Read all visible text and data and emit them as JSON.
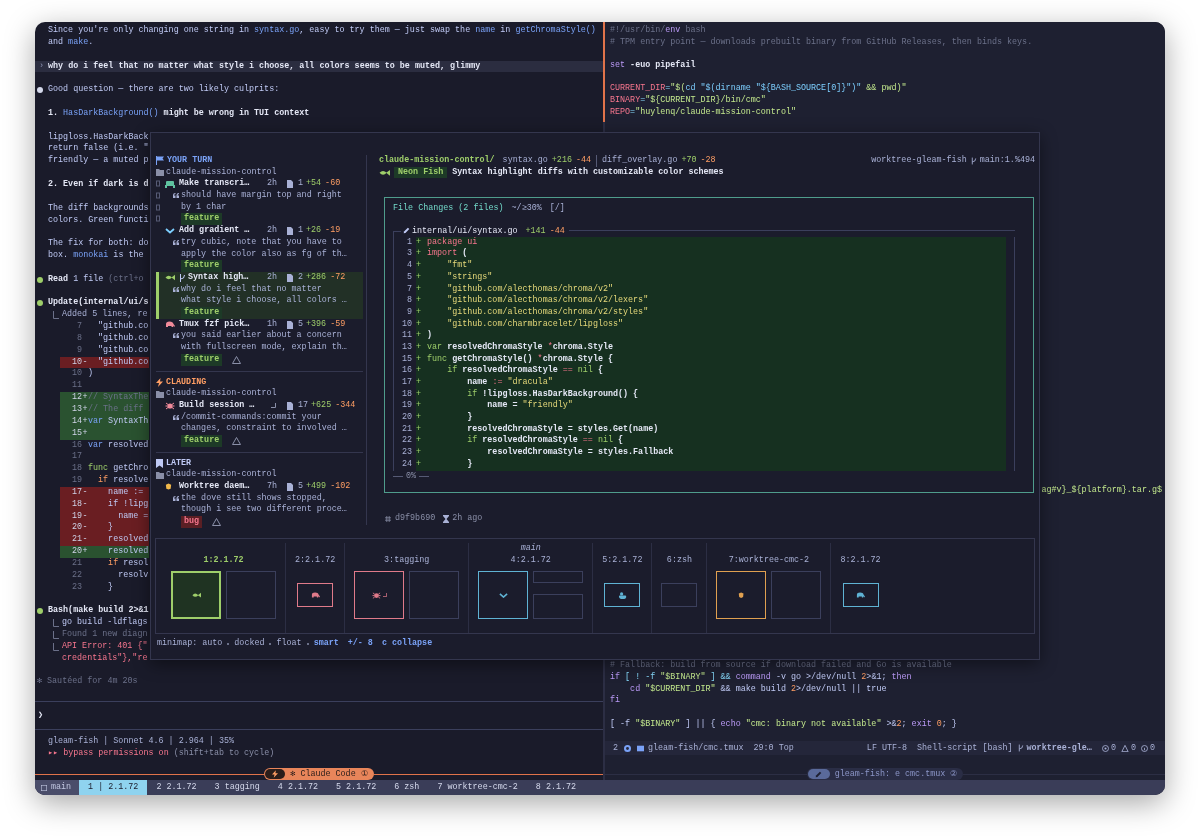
{
  "claude_pane": {
    "lines": [
      {
        "kind": "text",
        "parts": [
          {
            "t": "Since you're only changing one string in ",
            "kind": "plain"
          },
          {
            "t": "syntax.go",
            "kind": "code"
          },
          {
            "t": ", easy to try them — just swap the ",
            "kind": "plain"
          },
          {
            "t": "name",
            "kind": "code"
          },
          {
            "t": " in ",
            "kind": "plain"
          },
          {
            "t": "getChromaStyle()",
            "kind": "code"
          }
        ]
      },
      {
        "kind": "text",
        "parts": [
          {
            "t": "and ",
            "kind": "plain"
          },
          {
            "t": "make",
            "kind": "code"
          },
          {
            "t": ".",
            "kind": "plain"
          }
        ]
      },
      {
        "kind": "blank"
      },
      {
        "kind": "user",
        "marker": "›",
        "parts": [
          {
            "t": "why do i feel that no matter what style i choose, all colors seems to be muted, glimmy",
            "kind": "bold"
          }
        ]
      },
      {
        "kind": "blank"
      },
      {
        "kind": "bullet",
        "color": "#d5d9ec",
        "parts": [
          {
            "t": "Good question — there are two likely culprits:",
            "kind": "plain"
          }
        ]
      },
      {
        "kind": "blank"
      },
      {
        "kind": "text",
        "parts": [
          {
            "t": "1. ",
            "kind": "bold"
          },
          {
            "t": "HasDarkBackground()",
            "kind": "code"
          },
          {
            "t": " might be wrong in TUI context",
            "kind": "bold"
          }
        ]
      },
      {
        "kind": "blank"
      },
      {
        "kind": "text",
        "parts": [
          {
            "t": "lipgloss.HasDarkBack",
            "kind": "plain"
          }
        ]
      },
      {
        "kind": "text",
        "parts": [
          {
            "t": "return false (i.e. \"",
            "kind": "plain"
          }
        ]
      },
      {
        "kind": "text",
        "parts": [
          {
            "t": "friendly — a muted p",
            "kind": "plain"
          }
        ]
      },
      {
        "kind": "blank"
      },
      {
        "kind": "text",
        "parts": [
          {
            "t": "2. Even if dark is d",
            "kind": "bold"
          }
        ]
      },
      {
        "kind": "blank"
      },
      {
        "kind": "text",
        "parts": [
          {
            "t": "The diff backgrounds",
            "kind": "plain"
          }
        ]
      },
      {
        "kind": "text",
        "parts": [
          {
            "t": "colors. Green functi",
            "kind": "plain"
          }
        ]
      },
      {
        "kind": "blank"
      },
      {
        "kind": "text",
        "parts": [
          {
            "t": "The fix for both: do",
            "kind": "plain"
          }
        ]
      },
      {
        "kind": "text",
        "parts": [
          {
            "t": "box. ",
            "kind": "plain"
          },
          {
            "t": "monokai",
            "kind": "code"
          },
          {
            "t": " is the",
            "kind": "plain"
          }
        ]
      },
      {
        "kind": "blank"
      },
      {
        "kind": "bullet",
        "color": "#9ece6a",
        "parts": [
          {
            "t": "Read",
            "kind": "bold"
          },
          {
            "t": " 1 file ",
            "kind": "plain"
          },
          {
            "t": "(ctrl+o",
            "kind": "dim"
          }
        ]
      },
      {
        "kind": "blank"
      },
      {
        "kind": "bullet",
        "color": "#9ece6a",
        "parts": [
          {
            "t": "Update(internal/ui/s",
            "kind": "bold"
          }
        ]
      },
      {
        "kind": "output",
        "parts": [
          {
            "t": "Added 5 lines, re",
            "kind": "muted"
          }
        ]
      },
      {
        "kind": "diff_ctx",
        "num": "7",
        "parts": [
          {
            "t": "  \"github.co",
            "kind": "plain"
          }
        ]
      },
      {
        "kind": "diff_ctx",
        "num": "8",
        "parts": [
          {
            "t": "  \"github.co",
            "kind": "plain"
          }
        ]
      },
      {
        "kind": "diff_ctx",
        "num": "9",
        "parts": [
          {
            "t": "  \"github.co",
            "kind": "plain"
          }
        ]
      },
      {
        "kind": "diff_del",
        "num": "10",
        "sign": "-",
        "parts": [
          {
            "t": "  \"github.co",
            "kind": "plain"
          }
        ]
      },
      {
        "kind": "diff_ctx",
        "num": "10",
        "parts": [
          {
            "t": ")",
            "kind": "plain"
          }
        ]
      },
      {
        "kind": "diff_ctx",
        "num": "11"
      },
      {
        "kind": "diff_add",
        "num": "12",
        "sign": "+",
        "parts": [
          {
            "t": "// SyntaxThe",
            "kind": "dim"
          }
        ]
      },
      {
        "kind": "diff_add",
        "num": "13",
        "sign": "+",
        "parts": [
          {
            "t": "// The diff",
            "kind": "dim"
          }
        ]
      },
      {
        "kind": "diff_add",
        "num": "14",
        "sign": "+",
        "parts": [
          {
            "t": "var",
            "kind": "code"
          },
          {
            "t": " SyntaxTh",
            "kind": "plain"
          }
        ]
      },
      {
        "kind": "diff_add",
        "num": "15",
        "sign": "+"
      },
      {
        "kind": "diff_ctx",
        "num": "16",
        "parts": [
          {
            "t": "var",
            "kind": "code"
          },
          {
            "t": " resolved",
            "kind": "plain"
          }
        ]
      },
      {
        "kind": "diff_ctx",
        "num": "17"
      },
      {
        "kind": "diff_ctx",
        "num": "18",
        "parts": [
          {
            "t": "func",
            "kind": "gokw"
          },
          {
            "t": " getChro",
            "kind": "plain"
          }
        ]
      },
      {
        "kind": "diff_ctx",
        "num": "19",
        "parts": [
          {
            "t": "  if",
            "kind": "num"
          },
          {
            "t": " resolve",
            "kind": "plain"
          }
        ]
      },
      {
        "kind": "diff_del",
        "num": "17",
        "sign": "-",
        "parts": [
          {
            "t": "    name :=",
            "kind": "plain"
          }
        ]
      },
      {
        "kind": "diff_del",
        "num": "18",
        "sign": "-",
        "parts": [
          {
            "t": "    if !lipg",
            "kind": "plain"
          }
        ]
      },
      {
        "kind": "diff_del",
        "num": "19",
        "sign": "-",
        "parts": [
          {
            "t": "      name =",
            "kind": "plain"
          }
        ]
      },
      {
        "kind": "diff_del",
        "num": "20",
        "sign": "-",
        "parts": [
          {
            "t": "    }",
            "kind": "plain"
          }
        ]
      },
      {
        "kind": "diff_del",
        "num": "21",
        "sign": "-",
        "parts": [
          {
            "t": "    resolved",
            "kind": "plain"
          }
        ]
      },
      {
        "kind": "diff_add",
        "num": "20",
        "sign": "+",
        "parts": [
          {
            "t": "    resolved",
            "kind": "plain"
          }
        ]
      },
      {
        "kind": "diff_ctx",
        "num": "21",
        "parts": [
          {
            "t": "    if",
            "kind": "num"
          },
          {
            "t": " resol",
            "kind": "plain"
          }
        ]
      },
      {
        "kind": "diff_ctx",
        "num": "22",
        "parts": [
          {
            "t": "      resolv",
            "kind": "plain"
          }
        ]
      },
      {
        "kind": "diff_ctx",
        "num": "23",
        "parts": [
          {
            "t": "    }",
            "kind": "plain"
          }
        ]
      },
      {
        "kind": "blank"
      },
      {
        "kind": "bullet",
        "color": "#9ece6a",
        "parts": [
          {
            "t": "Bash(make build 2>&1",
            "kind": "bold"
          }
        ]
      },
      {
        "kind": "output",
        "parts": [
          {
            "t": "go build -ldflags",
            "kind": "plain"
          }
        ]
      },
      {
        "kind": "output",
        "parts": [
          {
            "t": "Found 1 new diagn",
            "kind": "dim"
          }
        ]
      },
      {
        "kind": "output",
        "parts": [
          {
            "t": "API Error: 401 {\"",
            "kind": "error"
          }
        ]
      },
      {
        "kind": "output_cont",
        "parts": [
          {
            "t": "credentials\"},\"re",
            "kind": "error"
          }
        ]
      },
      {
        "kind": "blank"
      },
      {
        "kind": "note",
        "parts": [
          {
            "t": "✻ Sautéed for 4m 20s",
            "kind": "dim"
          }
        ]
      }
    ],
    "prompt": "❯",
    "status": "gleam-fish | Sonnet 4.6 | 2.964 | 35%",
    "mode": {
      "marker": "▸▸",
      "label": "bypass permissions on",
      "hint": "(shift+tab to cycle)"
    },
    "border_title": "✻ Claude Code ①"
  },
  "editor_pane": {
    "top_lines": [
      {
        "kind": "code",
        "parts": [
          {
            "t": "#!/usr/bin/",
            "kind": "dim"
          },
          {
            "t": "env",
            "kind": "kw"
          },
          {
            "t": " bash",
            "kind": "dim"
          }
        ]
      },
      {
        "kind": "code",
        "parts": [
          {
            "t": "# TPM entry point — downloads prebuilt binary from GitHub Releases, then binds keys.",
            "kind": "dim"
          }
        ]
      },
      {
        "kind": "blank"
      },
      {
        "kind": "code",
        "parts": [
          {
            "t": "set",
            "kind": "kw"
          },
          {
            "t": " -euo pipefail",
            "kind": "bold"
          }
        ]
      },
      {
        "kind": "blank"
      },
      {
        "kind": "code",
        "parts": [
          {
            "t": "CURRENT_DIR",
            "kind": "var"
          },
          {
            "t": "=",
            "kind": "op"
          },
          {
            "t": "\"$(",
            "kind": "str"
          },
          {
            "t": "cd \"$(dirname \"${BASH_SOURCE[0]}\")\"",
            "kind": "interp"
          },
          {
            "t": " && pwd)\"",
            "kind": "str"
          }
        ]
      },
      {
        "kind": "code",
        "parts": [
          {
            "t": "BINARY",
            "kind": "var"
          },
          {
            "t": "=",
            "kind": "op"
          },
          {
            "t": "\"${CURRENT_DIR}/bin/cmc\"",
            "kind": "str"
          }
        ]
      },
      {
        "kind": "code",
        "parts": [
          {
            "t": "REPO",
            "kind": "var"
          },
          {
            "t": "=",
            "kind": "op"
          },
          {
            "t": "\"huylenq/claude-mission-control\"",
            "kind": "str"
          }
        ]
      }
    ],
    "side_line": {
      "kind": "code",
      "parts": [
        {
          "t": "ag#v}_${platform}.tar.g$",
          "kind": "str"
        }
      ]
    },
    "bottom_lines": [
      {
        "kind": "code",
        "parts": [
          {
            "t": "# Fallback: build from source if download failed and Go is available",
            "kind": "dim"
          }
        ]
      },
      {
        "kind": "code",
        "parts": [
          {
            "t": "if",
            "kind": "kw"
          },
          {
            "t": " [ ! -f ",
            "kind": "op"
          },
          {
            "t": "\"$BINARY\"",
            "kind": "str"
          },
          {
            "t": " ] && ",
            "kind": "op"
          },
          {
            "t": "command",
            "kind": "kw"
          },
          {
            "t": " -v go >/dev/null ",
            "kind": "plain"
          },
          {
            "t": "2",
            "kind": "num"
          },
          {
            "t": ">&1; ",
            "kind": "plain"
          },
          {
            "t": "then",
            "kind": "kw"
          }
        ]
      },
      {
        "kind": "code",
        "parts": [
          {
            "t": "    cd ",
            "kind": "kw"
          },
          {
            "t": "\"$CURRENT_DIR\"",
            "kind": "str"
          },
          {
            "t": " && make build ",
            "kind": "plain"
          },
          {
            "t": "2",
            "kind": "num"
          },
          {
            "t": ">/dev/null || true",
            "kind": "plain"
          }
        ]
      },
      {
        "kind": "code",
        "parts": [
          {
            "t": "fi",
            "kind": "kw"
          }
        ]
      },
      {
        "kind": "blank"
      },
      {
        "kind": "code",
        "parts": [
          {
            "t": "[ -f ",
            "kind": "plain"
          },
          {
            "t": "\"$BINARY\"",
            "kind": "str"
          },
          {
            "t": " ] || { ",
            "kind": "plain"
          },
          {
            "t": "echo",
            "kind": "kw"
          },
          {
            "t": " \"cmc: binary not available\"",
            "kind": "str"
          },
          {
            "t": " >&",
            "kind": "plain"
          },
          {
            "t": "2",
            "kind": "num"
          },
          {
            "t": "; ",
            "kind": "plain"
          },
          {
            "t": "exit ",
            "kind": "kw"
          },
          {
            "t": "0",
            "kind": "num"
          },
          {
            "t": "; }",
            "kind": "plain"
          }
        ]
      }
    ],
    "status_line": {
      "pane": "2",
      "file": "gleam-fish/cmc.tmux",
      "position": "29:0",
      "scroll": "Top",
      "eol": "LF",
      "encoding": "UTF-8",
      "filetype": "Shell-script [bash]",
      "branch": "worktree-gle…",
      "errors": "0",
      "warnings": "0",
      "infos": "0"
    },
    "border_title": "gleam-fish: e cmc.tmux ②"
  },
  "overlay": {
    "groups": [
      {
        "kind": "turn",
        "label": "YOUR TURN",
        "folder": "claude-mission-control",
        "sessions": [
          {
            "kind": "creature",
            "color": "#5fc2a0",
            "title": "Make transcri…",
            "branch": false,
            "busy": false,
            "age": "2h",
            "files": "1",
            "added": "+54",
            "removed": "-60",
            "quote_lines": [
              "should have margin top and right",
              "by 1 char"
            ],
            "tag": {
              "label": "feature",
              "kind": "feature"
            },
            "warning": false,
            "marked": true,
            "selected": false
          },
          {
            "kind": "chevron",
            "color": "#7dcfff",
            "title": "Add gradient …",
            "branch": false,
            "busy": false,
            "age": "2h",
            "files": "1",
            "added": "+26",
            "removed": "-19",
            "quote_lines": [
              "try cubic, note that you have to",
              "apply the color also as fg of th…"
            ],
            "tag": {
              "label": "feature",
              "kind": "feature"
            },
            "warning": false,
            "marked": false,
            "selected": false
          },
          {
            "kind": "fish",
            "color": "#9ece6a",
            "title": "Syntax high…",
            "branch": true,
            "busy": false,
            "age": "2h",
            "files": "2",
            "added": "+286",
            "removed": "-72",
            "quote_lines": [
              "why do i feel that no matter",
              "what style i choose, all colors …"
            ],
            "tag": {
              "label": "feature",
              "kind": "feature"
            },
            "warning": false,
            "marked": false,
            "selected": true
          },
          {
            "kind": "elephant",
            "color": "#f08a9a",
            "title": "Tmux fzf pick…",
            "branch": false,
            "busy": false,
            "age": "1h",
            "files": "5",
            "added": "+396",
            "removed": "-59",
            "quote_lines": [
              "you said earlier about a concern",
              "with fullscreen mode, explain th…"
            ],
            "tag": {
              "label": "feature",
              "kind": "feature"
            },
            "warning": true,
            "marked": false,
            "selected": false
          }
        ]
      },
      {
        "kind": "busy",
        "label": "CLAUDING",
        "folder": "claude-mission-control",
        "sessions": [
          {
            "kind": "bug",
            "color": "#f08a9a",
            "title": "Build session …",
            "branch": false,
            "busy": true,
            "files": "17",
            "added": "+625",
            "removed": "-344",
            "quote_lines": [
              "/commit-commands:commit your",
              "changes, constraint to involved …"
            ],
            "tag": {
              "label": "feature",
              "kind": "feature"
            },
            "warning": true,
            "marked": false,
            "selected": false
          }
        ]
      },
      {
        "kind": "later",
        "label": "LATER",
        "folder": "claude-mission-control",
        "sessions": [
          {
            "kind": "blob",
            "color": "#f2b84b",
            "title": "Worktree daem…",
            "branch": false,
            "busy": false,
            "age": "7h",
            "files": "5",
            "added": "+499",
            "removed": "-102",
            "quote_lines": [
              "the dove still shows stopped,",
              "though i see two different proce…"
            ],
            "tag": {
              "label": "bug",
              "kind": "bug"
            },
            "warning": true,
            "marked": false,
            "selected": false
          }
        ]
      }
    ],
    "detail": {
      "repo": "claude-mission-control/",
      "files": [
        {
          "name": "syntax.go",
          "added": "+216",
          "removed": "-44"
        },
        {
          "name": "diff_overlay.go",
          "added": "+70",
          "removed": "-28"
        }
      ],
      "worktree": "worktree-gleam-fish",
      "branch": "main:1.%494",
      "agent": "Neon Fish",
      "title": "Syntax highlight diffs with customizable color schemes",
      "changes": {
        "title": "File Changes (2 files)",
        "scope": "~/≥30%",
        "filter": "[/]",
        "file": {
          "path": "internal/ui/syntax.go",
          "added": "+141",
          "removed": "-44",
          "progress": "0%",
          "lines": [
            {
              "num": "1",
              "sign": "+",
              "parts": [
                {
                  "t": "package ui",
                  "kind": "gopunct"
                }
              ]
            },
            {
              "num": "3",
              "sign": "+",
              "parts": [
                {
                  "t": "import",
                  "kind": "gopunct"
                },
                {
                  "t": " (",
                  "kind": "bold"
                }
              ]
            },
            {
              "num": "4",
              "sign": "+",
              "parts": [
                {
                  "t": "    \"fmt\"",
                  "kind": "gostr"
                }
              ]
            },
            {
              "num": "5",
              "sign": "+",
              "parts": [
                {
                  "t": "    \"strings\"",
                  "kind": "gostr"
                }
              ]
            },
            {
              "num": "7",
              "sign": "+",
              "parts": [
                {
                  "t": "    \"github.com/alecthomas/chroma/v2\"",
                  "kind": "gostr"
                }
              ]
            },
            {
              "num": "8",
              "sign": "+",
              "parts": [
                {
                  "t": "    \"github.com/alecthomas/chroma/v2/lexers\"",
                  "kind": "gostr"
                }
              ]
            },
            {
              "num": "9",
              "sign": "+",
              "parts": [
                {
                  "t": "    \"github.com/alecthomas/chroma/v2/styles\"",
                  "kind": "gostr"
                }
              ]
            },
            {
              "num": "10",
              "sign": "+",
              "parts": [
                {
                  "t": "    \"github.com/charmbracelet/lipgloss\"",
                  "kind": "gostr"
                }
              ]
            },
            {
              "num": "11",
              "sign": "+",
              "parts": [
                {
                  "t": ")",
                  "kind": "bold"
                }
              ]
            },
            {
              "num": "13",
              "sign": "+",
              "parts": [
                {
                  "t": "var",
                  "kind": "gokw"
                },
                {
                  "t": " resolvedChromaStyle ",
                  "kind": "bold"
                },
                {
                  "t": "*",
                  "kind": "gopunct"
                },
                {
                  "t": "chroma.Style",
                  "kind": "bold"
                }
              ]
            },
            {
              "num": "15",
              "sign": "+",
              "parts": [
                {
                  "t": "func",
                  "kind": "gokw"
                },
                {
                  "t": " getChromaStyle() ",
                  "kind": "bold"
                },
                {
                  "t": "*",
                  "kind": "gopunct"
                },
                {
                  "t": "chroma.Style {",
                  "kind": "bold"
                }
              ]
            },
            {
              "num": "16",
              "sign": "+",
              "parts": [
                {
                  "t": "    if",
                  "kind": "gokw"
                },
                {
                  "t": " resolvedChromaStyle ",
                  "kind": "bold"
                },
                {
                  "t": "==",
                  "kind": "gopunct"
                },
                {
                  "t": " nil",
                  "kind": "gokw"
                },
                {
                  "t": " {",
                  "kind": "bold"
                }
              ]
            },
            {
              "num": "17",
              "sign": "+",
              "parts": [
                {
                  "t": "        name ",
                  "kind": "bold"
                },
                {
                  "t": ":=",
                  "kind": "gopunct"
                },
                {
                  "t": " \"dracula\"",
                  "kind": "gostr"
                }
              ]
            },
            {
              "num": "18",
              "sign": "+",
              "parts": [
                {
                  "t": "        if",
                  "kind": "gokw"
                },
                {
                  "t": " !lipgloss.HasDarkBackground() {",
                  "kind": "bold"
                }
              ]
            },
            {
              "num": "19",
              "sign": "+",
              "parts": [
                {
                  "t": "            name = ",
                  "kind": "bold"
                },
                {
                  "t": "\"friendly\"",
                  "kind": "gostr"
                }
              ]
            },
            {
              "num": "20",
              "sign": "+",
              "parts": [
                {
                  "t": "        }",
                  "kind": "bold"
                }
              ]
            },
            {
              "num": "21",
              "sign": "+",
              "parts": [
                {
                  "t": "        resolvedChromaStyle = styles.Get(name)",
                  "kind": "bold"
                }
              ]
            },
            {
              "num": "22",
              "sign": "+",
              "parts": [
                {
                  "t": "        if",
                  "kind": "gokw"
                },
                {
                  "t": " resolvedChromaStyle ",
                  "kind": "bold"
                },
                {
                  "t": "==",
                  "kind": "gopunct"
                },
                {
                  "t": " nil",
                  "kind": "gokw"
                },
                {
                  "t": " {",
                  "kind": "bold"
                }
              ]
            },
            {
              "num": "23",
              "sign": "+",
              "parts": [
                {
                  "t": "            resolvedChromaStyle = styles.Fallback",
                  "kind": "bold"
                }
              ]
            },
            {
              "num": "24",
              "sign": "+",
              "parts": [
                {
                  "t": "        }",
                  "kind": "bold"
                }
              ]
            }
          ]
        }
      },
      "commit": "d9f9b690",
      "age": "2h ago"
    },
    "minimap": {
      "windows": [
        {
          "label": "1:2.1.72",
          "selected": true,
          "kind": "pair",
          "panes": [
            {
              "kind": "fish",
              "color": "#9ece6a",
              "active": true
            },
            {
              "kind": "empty",
              "active": false
            }
          ]
        },
        {
          "label": "2:2.1.72",
          "selected": false,
          "kind": "single",
          "panes": [
            {
              "kind": "elephant",
              "color": "#e07a8a",
              "active": false
            }
          ]
        },
        {
          "label": "3:tagging",
          "selected": false,
          "kind": "pair",
          "panes": [
            {
              "kind": "bug",
              "color": "#e07a8a",
              "busy": true,
              "active": false
            },
            {
              "kind": "empty",
              "active": false
            }
          ]
        },
        {
          "label": "4:2.1.72",
          "main_label": "main",
          "selected": false,
          "kind": "stack",
          "panes": [
            {
              "kind": "chevron",
              "color": "#5fb3d4",
              "active": false
            },
            {
              "kind": "empty",
              "active": false
            },
            {
              "kind": "empty",
              "active": false
            }
          ]
        },
        {
          "label": "5:2.1.72",
          "selected": false,
          "kind": "single",
          "panes": [
            {
              "kind": "duck",
              "color": "#5fb3d4",
              "active": false
            }
          ]
        },
        {
          "label": "6:zsh",
          "selected": false,
          "kind": "single",
          "panes": [
            {
              "kind": "empty",
              "active": false
            }
          ]
        },
        {
          "label": "7:worktree-cmc-2",
          "selected": false,
          "kind": "pair",
          "panes": [
            {
              "kind": "blob",
              "color": "#e0a050",
              "active": false
            },
            {
              "kind": "empty",
              "active": false
            }
          ]
        },
        {
          "label": "8:2.1.72",
          "selected": false,
          "kind": "single",
          "panes": [
            {
              "kind": "elephant",
              "color": "#5fb3d4",
              "active": false
            }
          ]
        }
      ],
      "label": "minimap:",
      "modes": [
        {
          "label": "auto",
          "selected": false
        },
        {
          "label": "docked",
          "selected": false
        },
        {
          "label": "float",
          "selected": false
        },
        {
          "label": "smart",
          "selected": true
        }
      ],
      "keys": [
        "+/- 8",
        "c collapse"
      ]
    }
  },
  "tmux_bar": {
    "session": "main",
    "windows": [
      {
        "label": "1 | 2.1.72",
        "selected": true
      },
      {
        "label": "2 2.1.72",
        "selected": false
      },
      {
        "label": "3 tagging",
        "selected": false
      },
      {
        "label": "4 2.1.72",
        "selected": false
      },
      {
        "label": "5 2.1.72",
        "selected": false
      },
      {
        "label": "6 zsh",
        "selected": false
      },
      {
        "label": "7 worktree-cmc-2",
        "selected": false
      },
      {
        "label": "8 2.1.72",
        "selected": false
      }
    ]
  }
}
